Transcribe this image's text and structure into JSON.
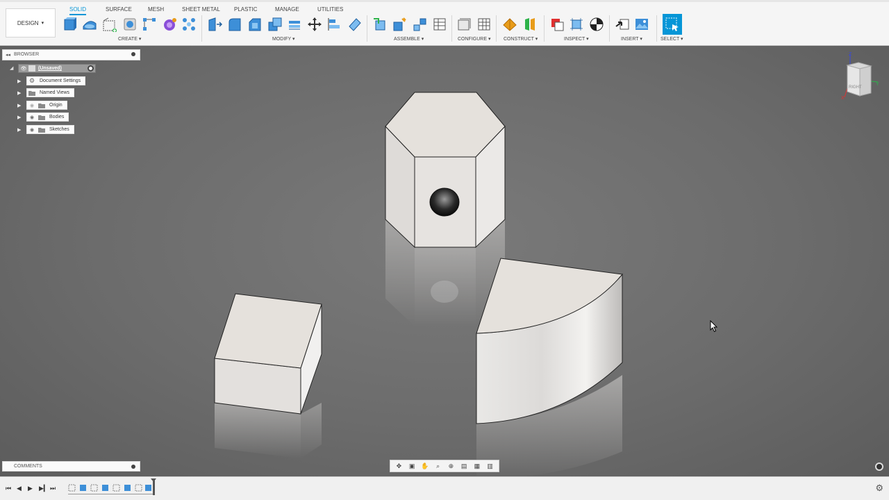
{
  "workspace": {
    "label": "DESIGN"
  },
  "tabs": [
    {
      "label": "SOLID",
      "active": true
    },
    {
      "label": "SURFACE",
      "active": false
    },
    {
      "label": "MESH",
      "active": false
    },
    {
      "label": "SHEET METAL",
      "active": false
    },
    {
      "label": "PLASTIC",
      "active": false
    },
    {
      "label": "MANAGE",
      "active": false
    },
    {
      "label": "UTILITIES",
      "active": false
    }
  ],
  "groups": {
    "create": "CREATE",
    "modify": "MODIFY",
    "assemble": "ASSEMBLE",
    "configure": "CONFIGURE",
    "construct": "CONSTRUCT",
    "inspect": "INSPECT",
    "insert": "INSERT",
    "select": "SELECT"
  },
  "browser": {
    "title": "BROWSER",
    "root": "(Unsaved)",
    "items": [
      {
        "label": "Document Settings",
        "icon": "gear-icon"
      },
      {
        "label": "Named Views",
        "icon": "folder-icon"
      },
      {
        "label": "Origin",
        "icon": "folder-icon"
      },
      {
        "label": "Bodies",
        "icon": "folder-icon"
      },
      {
        "label": "Sketches",
        "icon": "folder-icon"
      }
    ]
  },
  "comments": {
    "title": "COMMENTS"
  },
  "viewcube": {
    "face": "RIGHT",
    "axes": [
      "Z",
      "Y",
      "X"
    ]
  },
  "colors": {
    "accent": "#0696d7",
    "viewport": "#6e6e6e",
    "body": "#e8e5e2"
  },
  "timeline": {
    "feature_count": 8
  }
}
